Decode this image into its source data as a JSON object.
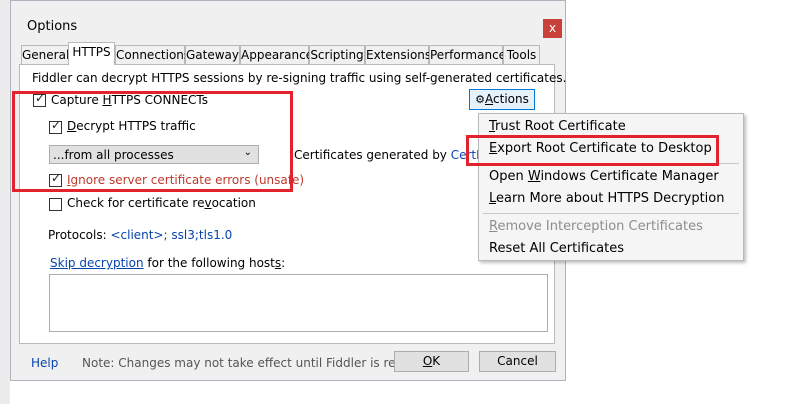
{
  "window": {
    "title": "Options",
    "close_glyph": "x"
  },
  "tabs": [
    {
      "label": "General",
      "active": false
    },
    {
      "label": "HTTPS",
      "active": true
    },
    {
      "label": "Connections",
      "active": false
    },
    {
      "label": "Gateway",
      "active": false
    },
    {
      "label": "Appearance",
      "active": false
    },
    {
      "label": "Scripting",
      "active": false
    },
    {
      "label": "Extensions",
      "active": false
    },
    {
      "label": "Performance",
      "active": false
    },
    {
      "label": "Tools",
      "active": false
    }
  ],
  "https": {
    "description": "Fiddler can decrypt HTTPS sessions by re-signing traffic using self-generated certificates.",
    "capture_connects": {
      "label_pre": "Capture ",
      "label_u": "H",
      "label_post": "TTPS CONNECTs",
      "checked": true
    },
    "decrypt_traffic": {
      "label_pre": "",
      "label_u": "D",
      "label_post": "ecrypt HTTPS traffic",
      "checked": true
    },
    "process_filter": {
      "selected": "...from all processes"
    },
    "cert_generated_label": "Certificates generated by ",
    "cert_engine_link": "CertEnroll e",
    "ignore_errors": {
      "label_pre": "",
      "label_u": "I",
      "label_post": "gnore server certificate errors (unsafe)",
      "checked": true
    },
    "check_revocation": {
      "label_pre": "Check for certificate re",
      "label_u": "v",
      "label_post": "ocation",
      "checked": false
    },
    "protocols_label": "Protocols: ",
    "protocols_value": "<client>; ssl3;tls1.0",
    "skip_link": "Skip decryption",
    "skip_rest_pre": " for the following host",
    "skip_rest_u": "s",
    "skip_rest_post": ":",
    "skip_hosts_value": ""
  },
  "actions_button": {
    "label_u": "A",
    "label_post": "ctions",
    "icon": "gear-icon"
  },
  "actions_menu": [
    {
      "pre": "",
      "u": "T",
      "post": "rust Root Certificate",
      "disabled": false
    },
    {
      "pre": "",
      "u": "E",
      "post": "xport Root Certificate to Desktop",
      "disabled": false
    },
    {
      "pre": "Open ",
      "u": "W",
      "post": "indows Certificate Manager",
      "disabled": false
    },
    {
      "pre": "",
      "u": "L",
      "post": "earn More about HTTPS Decryption",
      "disabled": false
    },
    {
      "pre": "",
      "u": "R",
      "post": "emove Interception Certificates",
      "disabled": true
    },
    {
      "pre": "Reset All Certificates",
      "u": "",
      "post": "",
      "disabled": false
    }
  ],
  "footer": {
    "help_link": "Help",
    "note": "Note: Changes may not take effect until Fiddler is restarted.",
    "ok_u": "O",
    "ok_post": "K",
    "cancel_label": "Cancel"
  },
  "colors": {
    "highlight_red": "#e2232e",
    "link_blue": "#0645ad",
    "close_red": "#c8423b",
    "error_red": "#c0392b"
  }
}
